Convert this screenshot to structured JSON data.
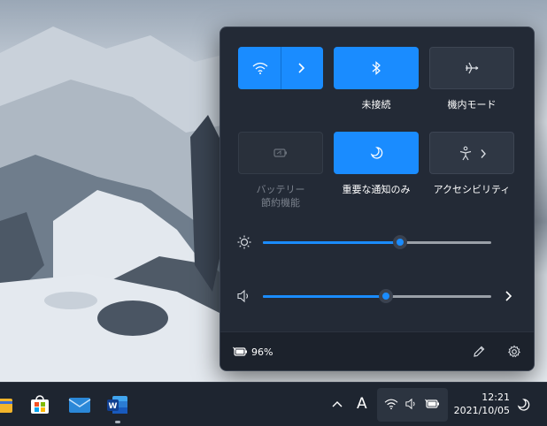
{
  "quick_settings": {
    "tiles": [
      {
        "id": "wifi",
        "label": "",
        "state": "on",
        "icon": "wifi-icon"
      },
      {
        "id": "bluetooth",
        "label": "未接続",
        "state": "on",
        "icon": "bluetooth-icon"
      },
      {
        "id": "airplane",
        "label": "機内モード",
        "state": "off",
        "icon": "airplane-icon"
      },
      {
        "id": "battery-saver",
        "label_line1": "バッテリー",
        "label_line2": "節約機能",
        "state": "disabled",
        "icon": "battery-saver-icon"
      },
      {
        "id": "focus-assist",
        "label": "重要な通知のみ",
        "state": "on",
        "icon": "moon-icon"
      },
      {
        "id": "accessibility",
        "label": "アクセシビリティ",
        "state": "off",
        "icon": "accessibility-icon"
      }
    ],
    "brightness": {
      "icon": "sun-icon",
      "level": 0.6
    },
    "volume": {
      "icon": "speaker-icon",
      "level": 0.54
    },
    "footer": {
      "battery_percent": "96%",
      "icons": [
        "battery-icon",
        "edit-pencil-icon",
        "gear-icon"
      ]
    }
  },
  "taskbar": {
    "apps": [
      "explorer-icon",
      "store-icon",
      "mail-icon",
      "word-icon"
    ],
    "tray": {
      "ime": "A",
      "time": "12:21",
      "date": "2021/10/05"
    }
  },
  "colors": {
    "accent": "#1a8cff",
    "panel": "#232a36",
    "tile_off": "#2f3744",
    "taskbar": "#1e2530"
  }
}
